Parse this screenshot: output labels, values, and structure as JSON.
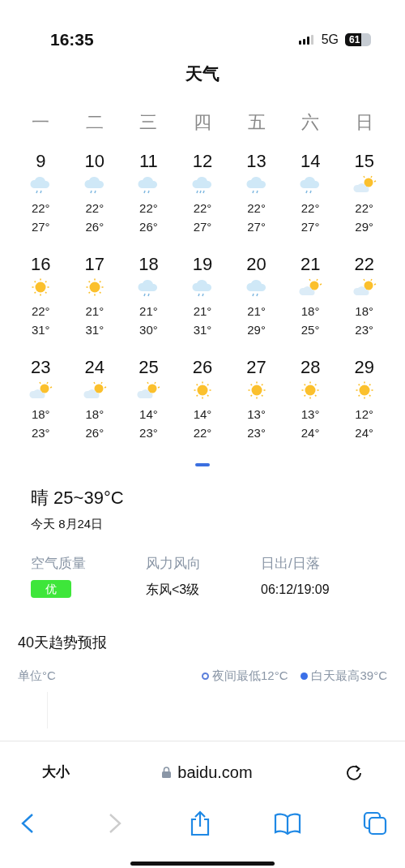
{
  "status_bar": {
    "time": "16:35",
    "network": "5G",
    "battery": "61"
  },
  "title": "天气",
  "weekdays": [
    "一",
    "二",
    "三",
    "四",
    "五",
    "六",
    "日"
  ],
  "days": [
    {
      "date": "9",
      "kind": "rain",
      "low": "22°",
      "high": "27°"
    },
    {
      "date": "10",
      "kind": "rain",
      "low": "22°",
      "high": "26°"
    },
    {
      "date": "11",
      "kind": "rain",
      "low": "22°",
      "high": "26°"
    },
    {
      "date": "12",
      "kind": "heavy-rain",
      "low": "22°",
      "high": "27°"
    },
    {
      "date": "13",
      "kind": "rain",
      "low": "22°",
      "high": "27°"
    },
    {
      "date": "14",
      "kind": "rain",
      "low": "22°",
      "high": "27°"
    },
    {
      "date": "15",
      "kind": "partly",
      "low": "22°",
      "high": "29°"
    },
    {
      "date": "16",
      "kind": "sunny",
      "low": "22°",
      "high": "31°"
    },
    {
      "date": "17",
      "kind": "sunny",
      "low": "21°",
      "high": "31°"
    },
    {
      "date": "18",
      "kind": "rain",
      "low": "21°",
      "high": "30°"
    },
    {
      "date": "19",
      "kind": "rain",
      "low": "21°",
      "high": "31°"
    },
    {
      "date": "20",
      "kind": "rain",
      "low": "21°",
      "high": "29°"
    },
    {
      "date": "21",
      "kind": "partly",
      "low": "18°",
      "high": "25°"
    },
    {
      "date": "22",
      "kind": "partly",
      "low": "18°",
      "high": "23°"
    },
    {
      "date": "23",
      "kind": "partly",
      "low": "18°",
      "high": "23°"
    },
    {
      "date": "24",
      "kind": "partly",
      "low": "18°",
      "high": "26°"
    },
    {
      "date": "25",
      "kind": "partly",
      "low": "14°",
      "high": "23°"
    },
    {
      "date": "26",
      "kind": "sunny",
      "low": "14°",
      "high": "22°"
    },
    {
      "date": "27",
      "kind": "sunny",
      "low": "13°",
      "high": "23°"
    },
    {
      "date": "28",
      "kind": "sunny",
      "low": "13°",
      "high": "24°"
    },
    {
      "date": "29",
      "kind": "sunny",
      "low": "12°",
      "high": "24°"
    }
  ],
  "today": {
    "summary": "晴 25~39°C",
    "date": "今天 8月24日",
    "details": [
      {
        "label": "空气质量",
        "value": "优",
        "kind": "badge"
      },
      {
        "label": "风力风向",
        "value": "东风<3级",
        "kind": "text"
      },
      {
        "label": "日出/日落",
        "value": "06:12/19:09",
        "kind": "text"
      }
    ]
  },
  "trend": {
    "title": "40天趋势预报",
    "unit": "单位°C",
    "legend": [
      {
        "label": "夜间最低12°C",
        "color": "#5b7fdb",
        "kind": "hollow"
      },
      {
        "label": "白天最高39°C",
        "color": "#3a6fe8",
        "kind": "filled"
      }
    ]
  },
  "browser": {
    "text_size": "大小",
    "url": "baidu.com",
    "back_disabled": false,
    "forward_disabled": true
  }
}
